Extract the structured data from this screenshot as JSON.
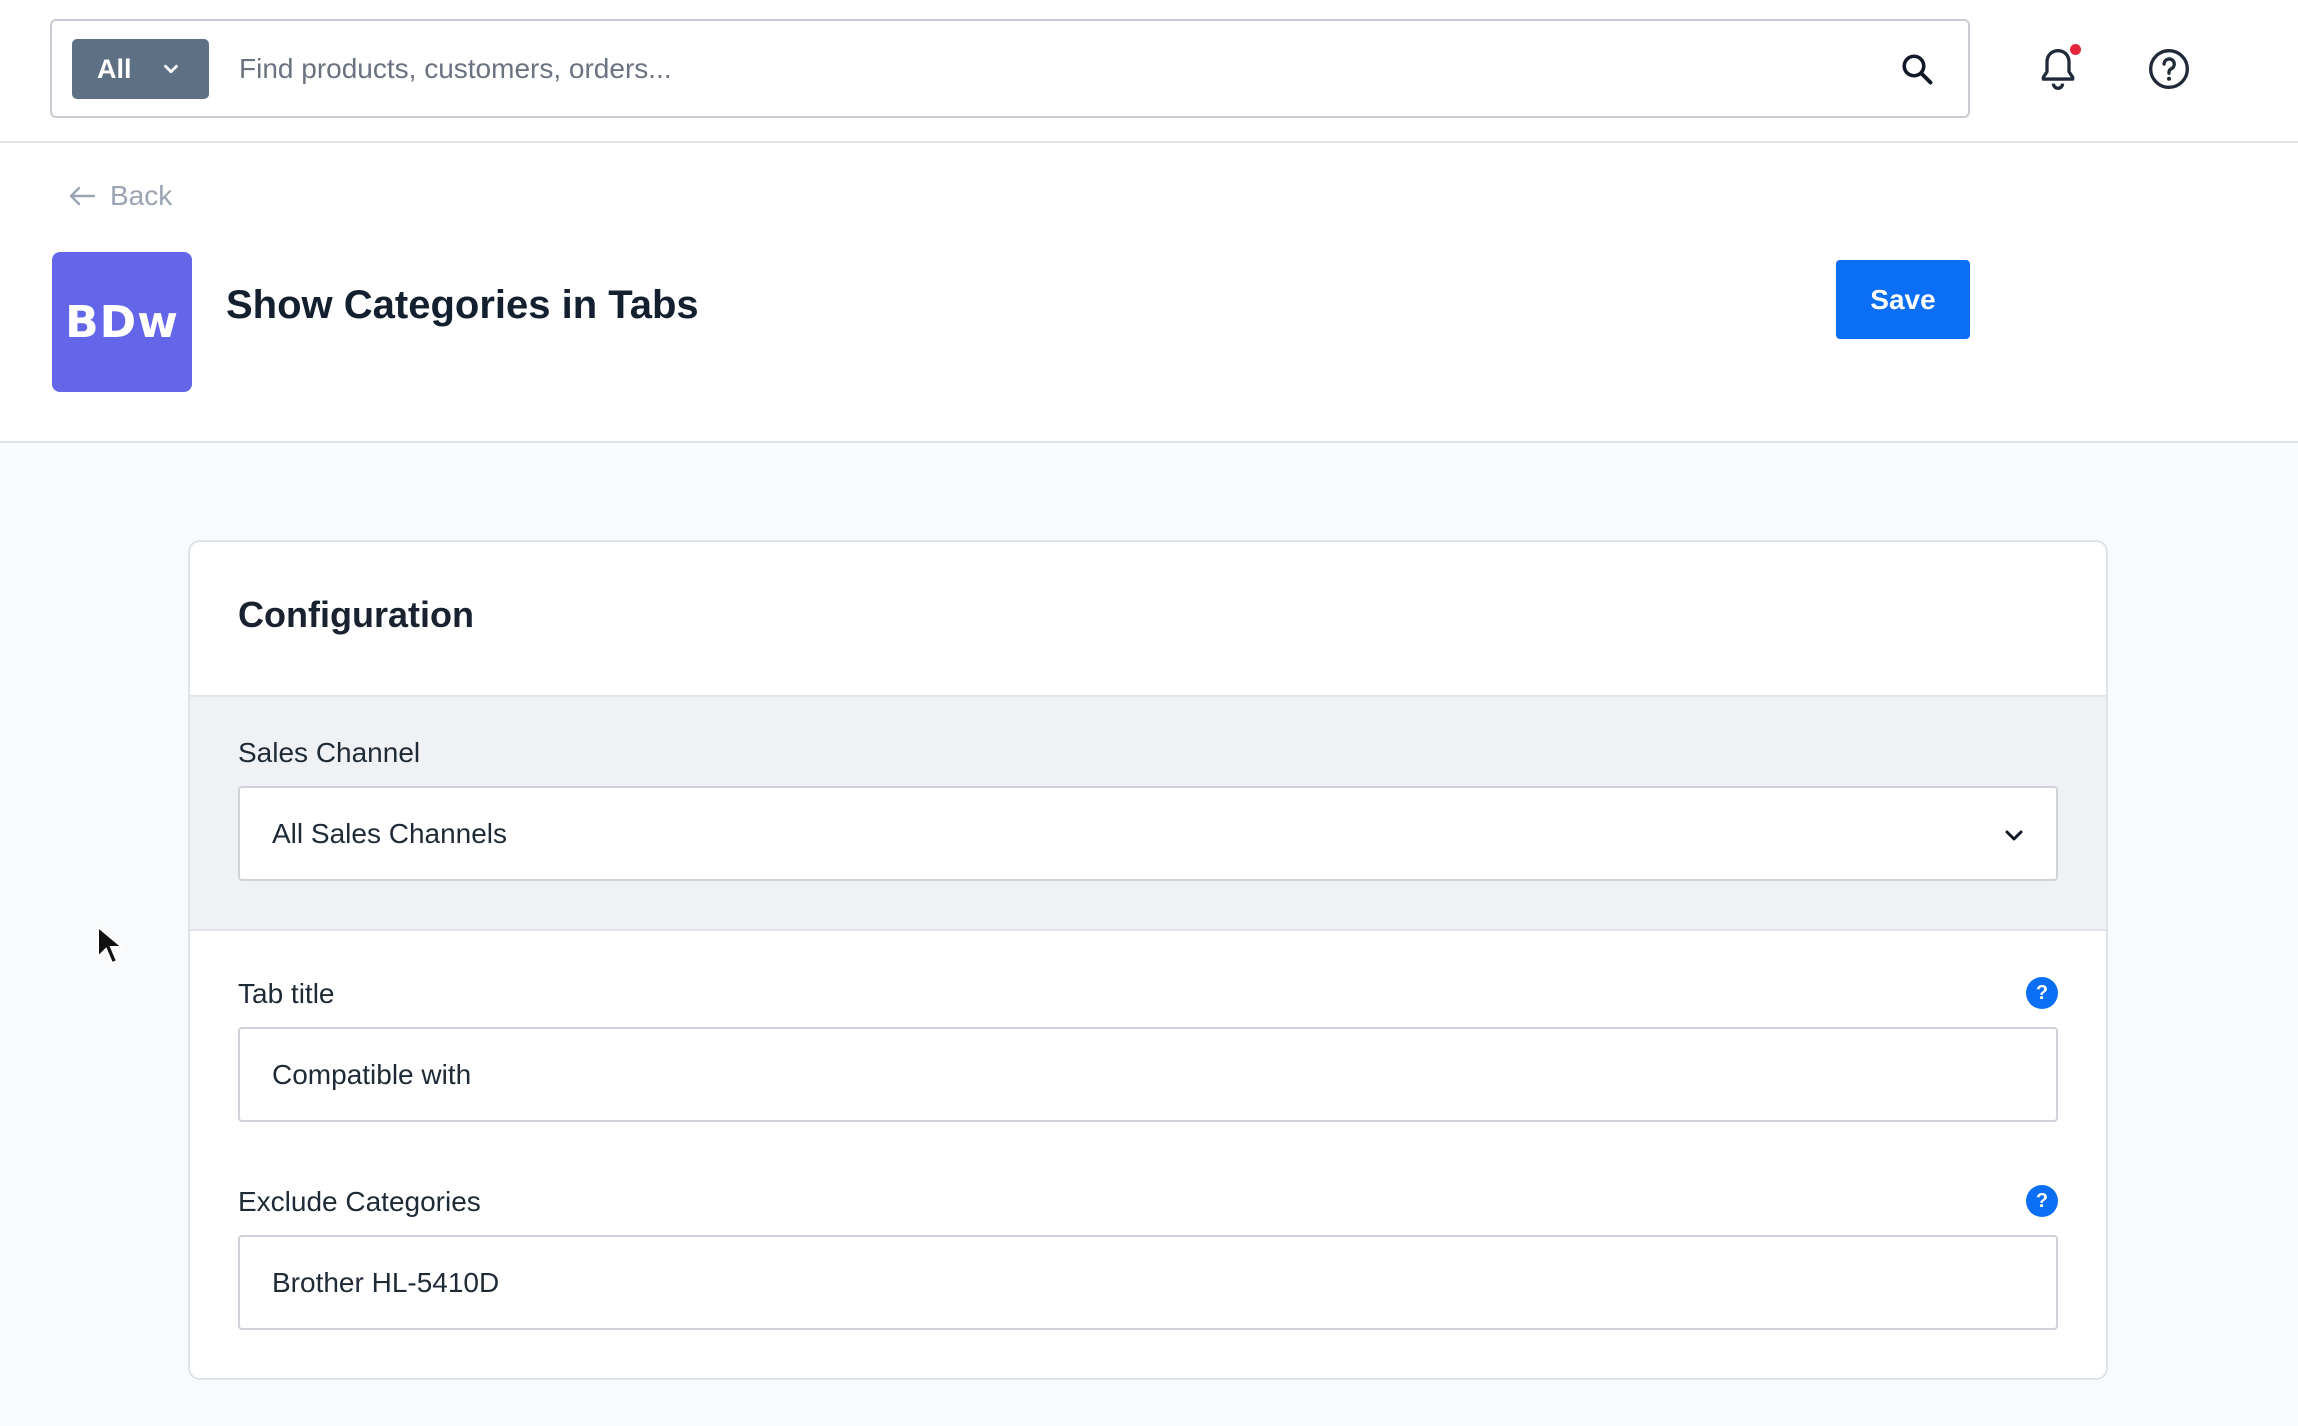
{
  "search": {
    "scope_label": "All",
    "placeholder": "Find products, customers, orders...",
    "value": ""
  },
  "header": {
    "back_label": "Back",
    "app_logo_text": "BDw",
    "title": "Show Categories in Tabs",
    "save_label": "Save"
  },
  "config": {
    "title": "Configuration",
    "sales_channel": {
      "label": "Sales Channel",
      "value": "All Sales Channels"
    },
    "tab_title": {
      "label": "Tab title",
      "value": "Compatible with",
      "help": "?"
    },
    "exclude_categories": {
      "label": "Exclude Categories",
      "value": "Brother HL-5410D",
      "help": "?"
    }
  },
  "colors": {
    "accent": "#0b6ff5",
    "logo_bg": "#6366e8",
    "scope_bg": "#5e7084",
    "notification_dot": "#e5263b"
  },
  "icons": [
    "chevron-down-icon",
    "search-icon",
    "bell-icon",
    "help-circle-icon",
    "arrow-left-icon",
    "help-icon",
    "mouse-cursor-icon"
  ]
}
